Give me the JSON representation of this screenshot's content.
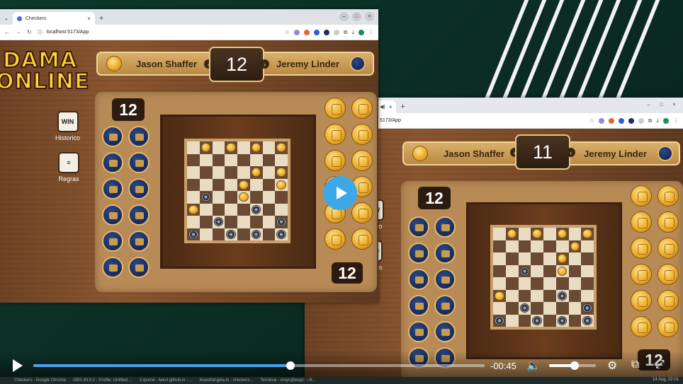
{
  "browser_left": {
    "tab_title": "Checkers",
    "url": "localhost:5173/App"
  },
  "browser_right": {
    "url": "5173/App"
  },
  "game_left": {
    "logo_line1": "DAMA",
    "logo_line2": "ONLINE",
    "player1": "Jason Shaffer",
    "player2": "Jeremy Linder",
    "turn_counter": "12",
    "score_top": "12",
    "score_bottom": "12",
    "history_label": "Historico",
    "history_icon_text": "WIN",
    "rules_label": "Regras",
    "board": [
      "_G_G_G_G",
      "________",
      "_____G_G",
      "____G__G",
      "_N__G___",
      "G____N__",
      "__N____N",
      "N__N_N_N"
    ]
  },
  "game_right": {
    "player1": "Jason Shaffer",
    "player2": "Jeremy Linder",
    "turn_counter": "11",
    "score_top": "12",
    "score_bottom": "12",
    "rules_label_partial": "ras",
    "history_label_partial": "rico",
    "board": [
      "_G_G_G_G",
      "______G_",
      "_____G__",
      "__N__G__",
      "________",
      "G____N__",
      "__N____N",
      "N__N_N_N"
    ]
  },
  "video": {
    "time_remaining": "-00:45",
    "progress": 0.57,
    "volume": 0.55
  },
  "taskbar": {
    "items": [
      "Checkers - Google Chrome",
      "OBS 30.0.2 - Profile: Untitled ...",
      "2-ipumd - lwecl.github.io - ...",
      "board/angela.ts - checkers...",
      "Terminal - moyc@eopc: ~/fr..."
    ],
    "clock": "14 Aug, 02:01"
  },
  "colors": {
    "accent_blue": "#3ea7e8",
    "wood": "#8a5630",
    "gold_piece": "#e7a923",
    "navy_piece": "#152a5c"
  }
}
